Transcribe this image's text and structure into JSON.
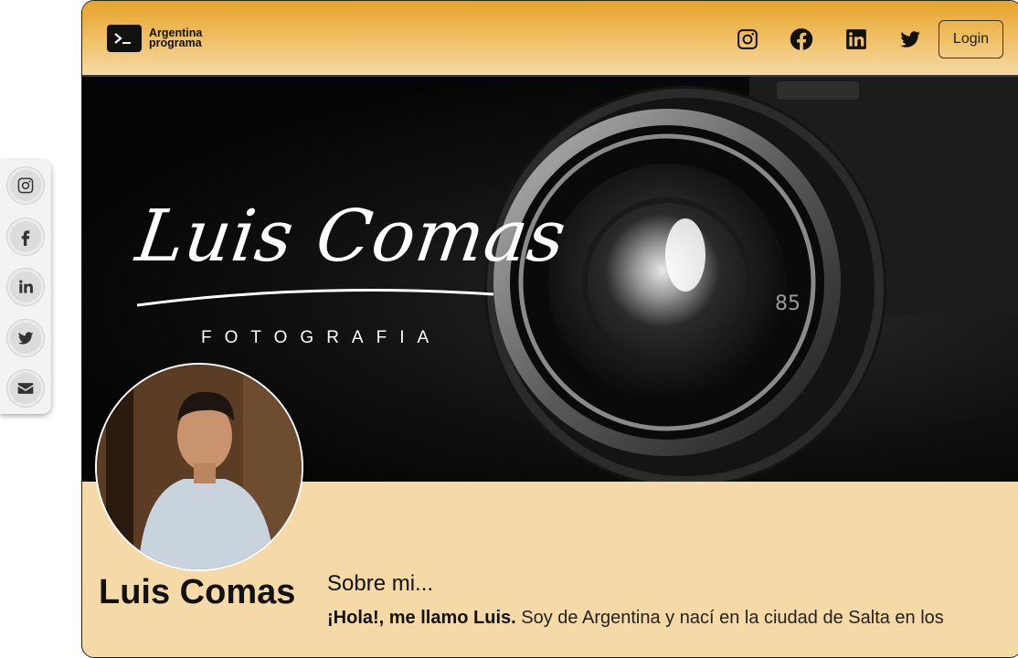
{
  "brand": {
    "name": "Argentina programa"
  },
  "nav": {
    "icons": [
      "instagram-icon",
      "facebook-icon",
      "linkedin-icon",
      "twitter-icon"
    ],
    "login_label": "Login"
  },
  "side_social": {
    "icons": [
      "instagram-icon",
      "facebook-icon",
      "linkedin-icon",
      "twitter-icon",
      "envelope-icon"
    ]
  },
  "banner": {
    "signature": "Luis Comas",
    "subtitle": "FOTOGRAFIA",
    "lens_marking": "85"
  },
  "profile": {
    "name": "Luis Comas"
  },
  "about": {
    "title": "Sobre mi...",
    "intro_bold": "¡Hola!, me llamo Luis.",
    "intro_rest": " Soy de Argentina y nací en la ciudad de Salta en los"
  },
  "colors": {
    "nav_top": "#e7a32b",
    "content_bg": "#f5d9a7",
    "accent_dark": "#111111"
  }
}
